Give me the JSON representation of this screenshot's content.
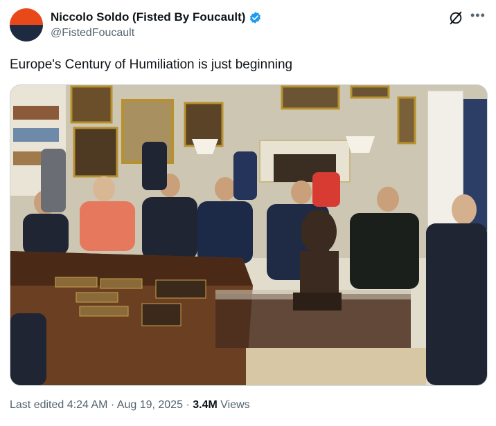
{
  "author": {
    "display_name": "Niccolo Soldo (Fisted By Foucault)",
    "handle": "@FistedFoucault",
    "verified_icon": "verified-badge-icon",
    "avatar_colors": [
      "#e8481a",
      "#1d2a3f"
    ]
  },
  "tweet": {
    "text": "Europe's Century of Humiliation is just beginning"
  },
  "footer": {
    "edited": "Last edited 4:24 AM",
    "separator": "·",
    "date": "Aug 19, 2025",
    "views_count": "3.4M",
    "views_label": "Views"
  },
  "colors": {
    "text_primary": "#0f1419",
    "text_secondary": "#536471",
    "verified": "#1d9bf0"
  }
}
